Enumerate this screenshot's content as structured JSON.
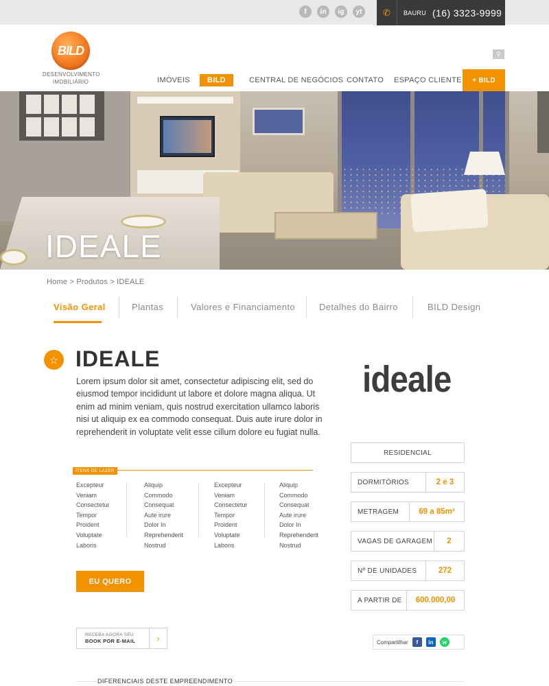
{
  "social": [
    "f",
    "in",
    "ig",
    "yt"
  ],
  "contact": {
    "city": "BAURU",
    "phone": "(16) 3323-9999",
    "icon": "phone-icon"
  },
  "logo": {
    "mark": "BILD",
    "line1": "DESENVOLVIMENTO",
    "line2": "IMOBILIÁRIO"
  },
  "nav": {
    "items": [
      "IMÓVEIS",
      "BILD",
      "CENTRAL DE NEGÓCIOS",
      "CONTATO",
      "ESPAÇO CLIENTE"
    ],
    "active": "BILD",
    "cta": "+ BILD"
  },
  "hero": {
    "title": "IDEALE"
  },
  "breadcrumb": {
    "home": "Home",
    "sep1": ">",
    "produtos": "Produtos",
    "sep2": ">",
    "current": "IDEALE"
  },
  "tabs": [
    "Visão Geral",
    "Plantas",
    "Valores e Financiamento",
    "Detalhes do Bairro",
    "BILD Design"
  ],
  "product": {
    "title": "IDEALE",
    "description": "Lorem ipsum dolor sit amet, consectetur adipiscing elit, sed do eiusmod tempor incididunt ut labore et dolore magna aliqua. Ut enim ad minim veniam, quis nostrud exercitation ullamco laboris nisi ut aliquip ex ea commodo consequat. Duis aute irure dolor in reprehenderit in voluptate velit esse cillum dolore eu fugiat nulla.",
    "brand_logo": "ideale"
  },
  "lazer": {
    "tag": "ÍTENS DE LAZER",
    "columns": [
      [
        "Excepteur",
        "Veniam",
        "Consectetur",
        "Tempor",
        "Proident",
        "Voluptate",
        "Laboris"
      ],
      [
        "Aliquip",
        "Commodo",
        "Consequat",
        "Aute irure",
        "Dolor In",
        "Reprehenderit",
        "Nostrud"
      ],
      [
        "Excepteur",
        "Veniam",
        "Consectetur",
        "Tempor",
        "Proident",
        "Voluptate",
        "Laboris"
      ],
      [
        "Aliquip",
        "Commodo",
        "Consequat",
        "Aute irure",
        "Dolor In",
        "Reprehenderit",
        "Nostrud"
      ]
    ]
  },
  "cta": {
    "quero": "EU QUERO"
  },
  "email": {
    "line1": "RECEBA AGORA SEU",
    "line2": "BOOK POR E-MAIL",
    "arrow": "›"
  },
  "specs": {
    "tipo": "RESIDENCIAL",
    "dormitorios": {
      "label": "DORMITÓRIOS",
      "value": "2 e 3"
    },
    "metragem": {
      "label": "METRAGEM",
      "value": "69 a 85m²"
    },
    "vagas": {
      "label": "VAGAS DE GARAGEM",
      "value": "2"
    },
    "unidades": {
      "label": "Nº DE UNIDADES",
      "value": "272"
    },
    "preco": {
      "label": "A PARTIR DE",
      "value": "600.000,00"
    }
  },
  "share": {
    "label": "Compartilhar",
    "icons": [
      "f",
      "in",
      "w"
    ]
  },
  "diferenciais": {
    "title": "DIFERENCIAIS DESTE EMPREENDIMENTO"
  },
  "colors": {
    "accent": "#f39200",
    "dark": "#3a3a3a",
    "brand_red": "#c8102e"
  }
}
